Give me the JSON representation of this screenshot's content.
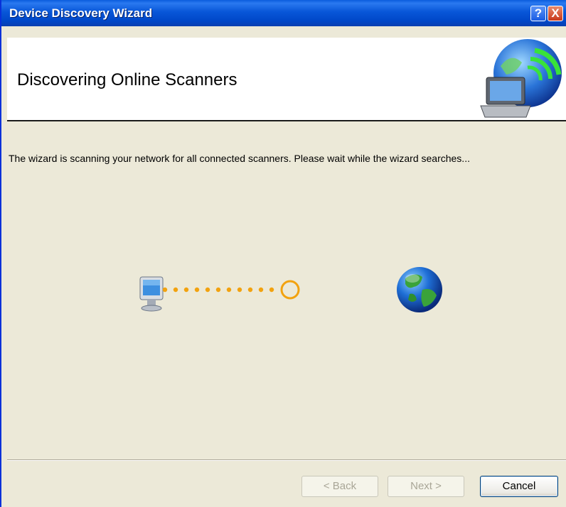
{
  "window": {
    "title": "Device Discovery Wizard"
  },
  "titlebar_buttons": {
    "help": "?",
    "close": "X"
  },
  "header": {
    "title": "Discovering Online Scanners"
  },
  "content": {
    "message": "The wizard is scanning your network for all connected scanners. Please wait while the wizard searches..."
  },
  "progress": {
    "dot_count": 11
  },
  "buttons": {
    "back": "< Back",
    "next": "Next >",
    "cancel": "Cancel"
  },
  "colors": {
    "titlebar_blue": "#0054e3",
    "dialog_bg": "#ece9d8",
    "progress_dot": "#f2a20f",
    "disabled_text": "#a9a697"
  }
}
